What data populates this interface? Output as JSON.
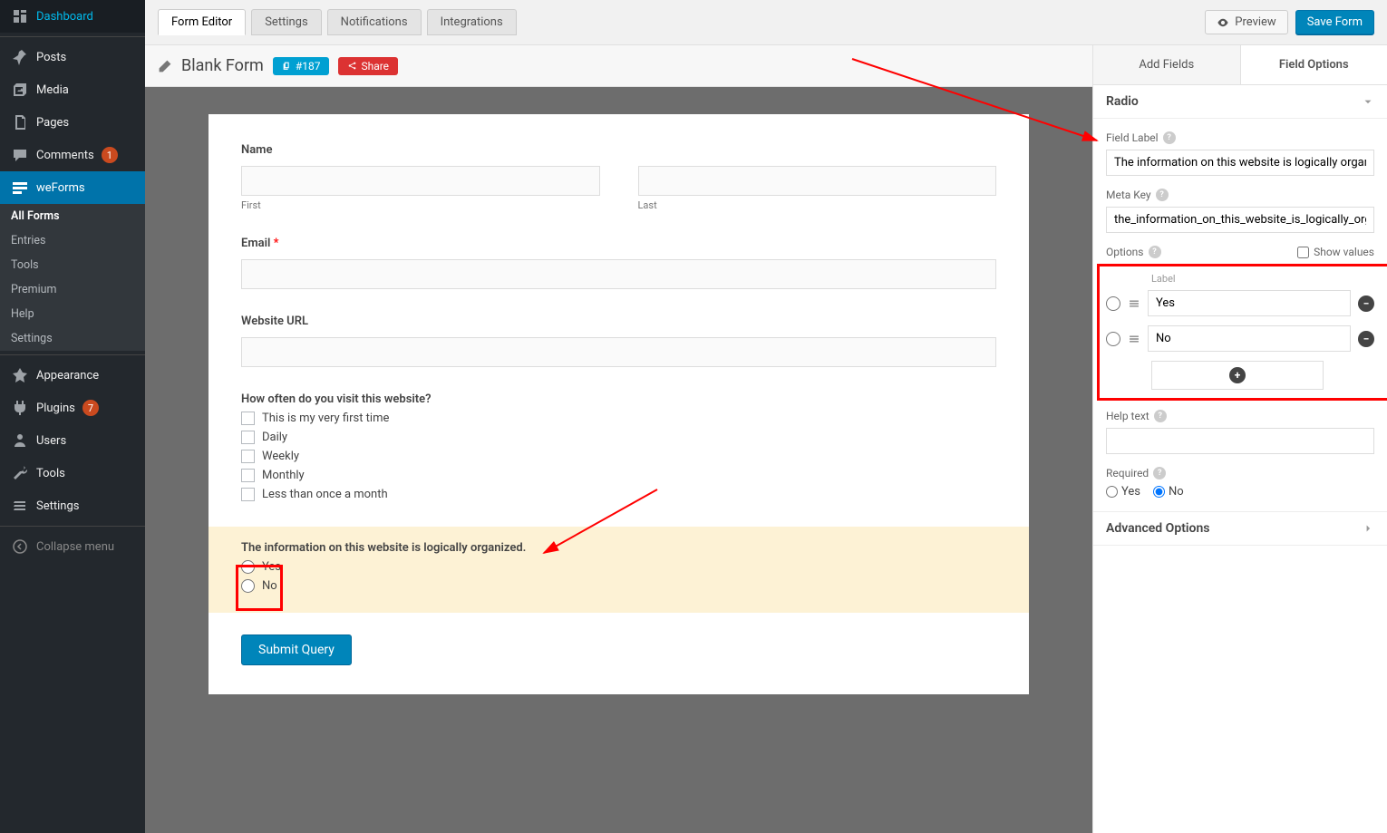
{
  "sidebar": {
    "items": [
      {
        "label": "Dashboard",
        "icon": "dashboard"
      },
      {
        "label": "Posts",
        "icon": "pin"
      },
      {
        "label": "Media",
        "icon": "media"
      },
      {
        "label": "Pages",
        "icon": "pages"
      },
      {
        "label": "Comments",
        "icon": "comment",
        "badge": "1"
      },
      {
        "label": "weForms",
        "icon": "weforms",
        "active": true
      },
      {
        "label": "Appearance",
        "icon": "appearance"
      },
      {
        "label": "Plugins",
        "icon": "plugin",
        "badge": "7"
      },
      {
        "label": "Users",
        "icon": "users"
      },
      {
        "label": "Tools",
        "icon": "tools"
      },
      {
        "label": "Settings",
        "icon": "settings"
      },
      {
        "label": "Collapse menu",
        "icon": "collapse"
      }
    ],
    "sub_items": [
      "All Forms",
      "Entries",
      "Tools",
      "Premium",
      "Help",
      "Settings"
    ]
  },
  "topbar": {
    "tabs": [
      "Form Editor",
      "Settings",
      "Notifications",
      "Integrations"
    ],
    "preview": "Preview",
    "save": "Save Form"
  },
  "titlebar": {
    "form_title": "Blank Form",
    "id_pill": "#187",
    "share_pill": "Share"
  },
  "form": {
    "name_label": "Name",
    "first_sub": "First",
    "last_sub": "Last",
    "email_label": "Email",
    "url_label": "Website URL",
    "visit_label": "How often do you visit this website?",
    "visit_options": [
      "This is my very first time",
      "Daily",
      "Weekly",
      "Monthly",
      "Less than once a month"
    ],
    "info_label": "The information on this website is logically organized.",
    "info_options": [
      "Yes",
      "No"
    ],
    "submit": "Submit Query"
  },
  "right_panel": {
    "tabs": [
      "Add Fields",
      "Field Options"
    ],
    "field_type": "Radio",
    "field_label_title": "Field Label",
    "field_label_value": "The information on this website is logically organized.",
    "meta_key_title": "Meta Key",
    "meta_key_value": "the_information_on_this_website_is_logically_organized",
    "options_title": "Options",
    "show_values": "Show values",
    "label_header": "Label",
    "options": [
      "Yes",
      "No"
    ],
    "help_text_title": "Help text",
    "required_title": "Required",
    "required_yes": "Yes",
    "required_no": "No",
    "advanced": "Advanced Options"
  }
}
